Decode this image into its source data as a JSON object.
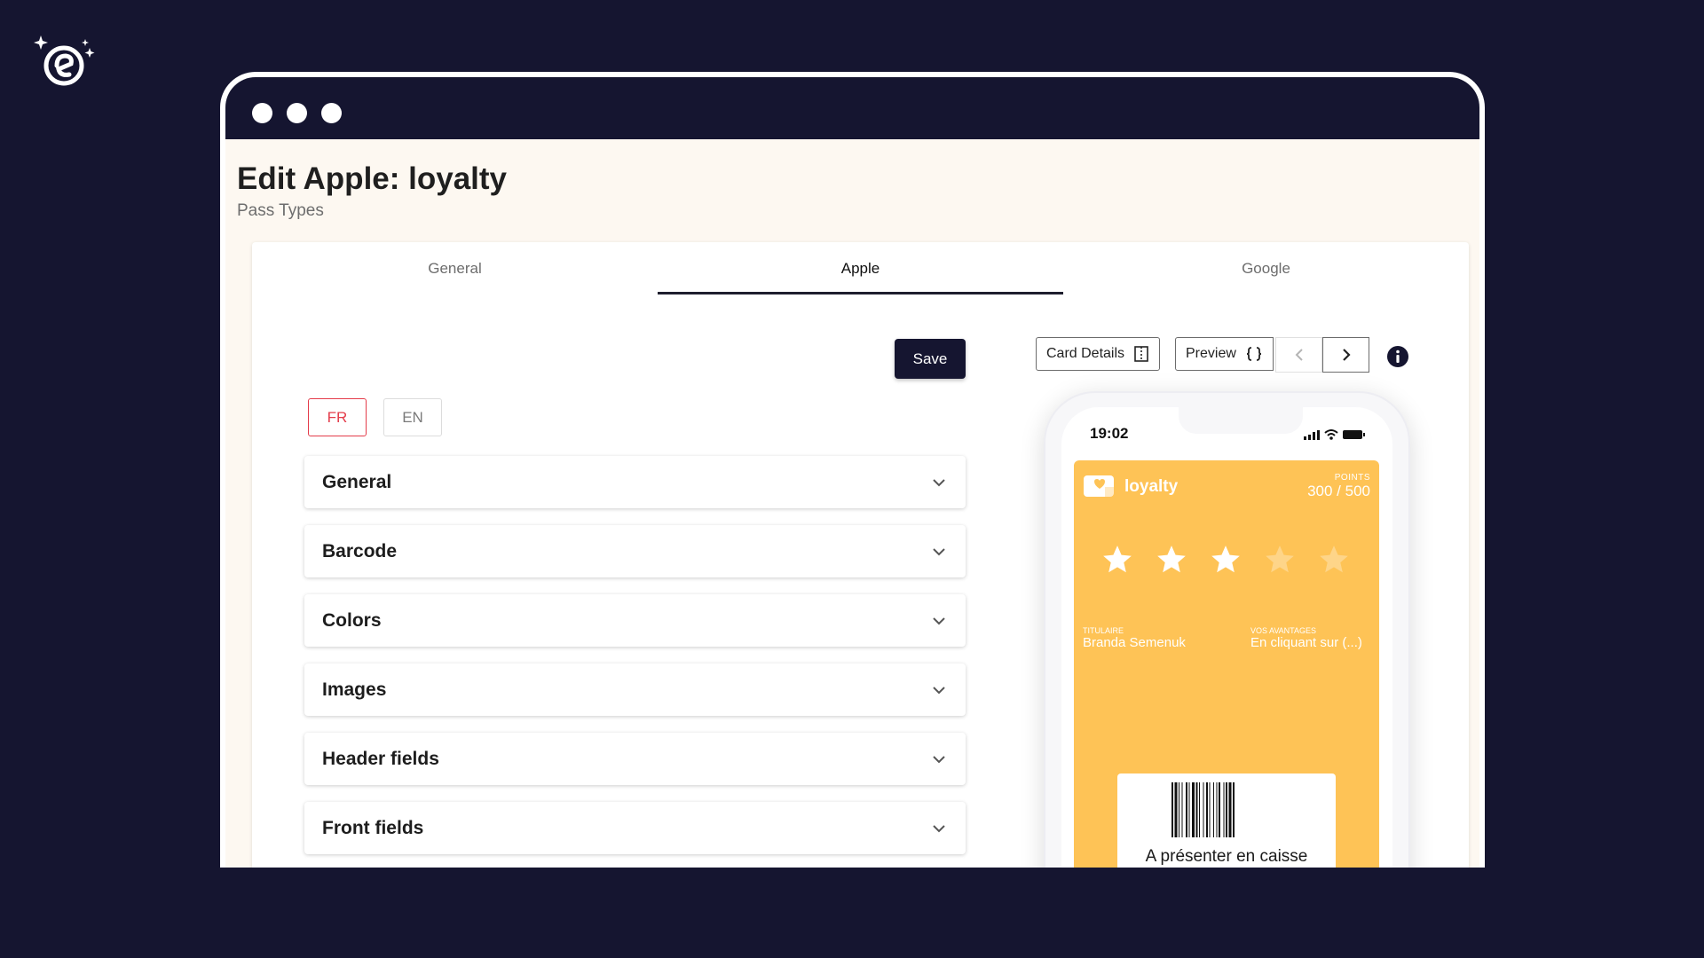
{
  "page": {
    "title": "Edit Apple: loyalty",
    "subtitle": "Pass Types"
  },
  "tabs": [
    {
      "label": "General",
      "active": false
    },
    {
      "label": "Apple",
      "active": true
    },
    {
      "label": "Google",
      "active": false
    }
  ],
  "editor": {
    "save_label": "Save",
    "languages": [
      {
        "code": "FR",
        "selected": true
      },
      {
        "code": "EN",
        "selected": false
      }
    ],
    "sections": [
      "General",
      "Barcode",
      "Colors",
      "Images",
      "Header fields",
      "Front fields"
    ]
  },
  "preview_toolbar": {
    "card_details_label": "Card Details",
    "preview_label": "Preview",
    "icons": [
      "split-view-icon",
      "braces-icon",
      "chevron-left-icon",
      "chevron-right-icon",
      "info-icon"
    ]
  },
  "phone": {
    "time": "19:02",
    "status_icons": [
      "signal-icon",
      "wifi-icon",
      "battery-icon"
    ]
  },
  "pass": {
    "name": "loyalty",
    "points_label": "POINTS",
    "points_value": "300 / 500",
    "stars_total": 5,
    "stars_filled": 3,
    "holder_label": "TITULAIRE",
    "holder_value": "Branda Semenuk",
    "benefits_label": "VOS AVANTAGES",
    "benefits_value": "En cliquant sur (...)",
    "barcode_caption": "A présenter en caisse",
    "background_color": "#fec356"
  },
  "colors": {
    "background": "#151530",
    "accent_red": "#e43c4a",
    "content_bg": "#fdf8f1"
  }
}
